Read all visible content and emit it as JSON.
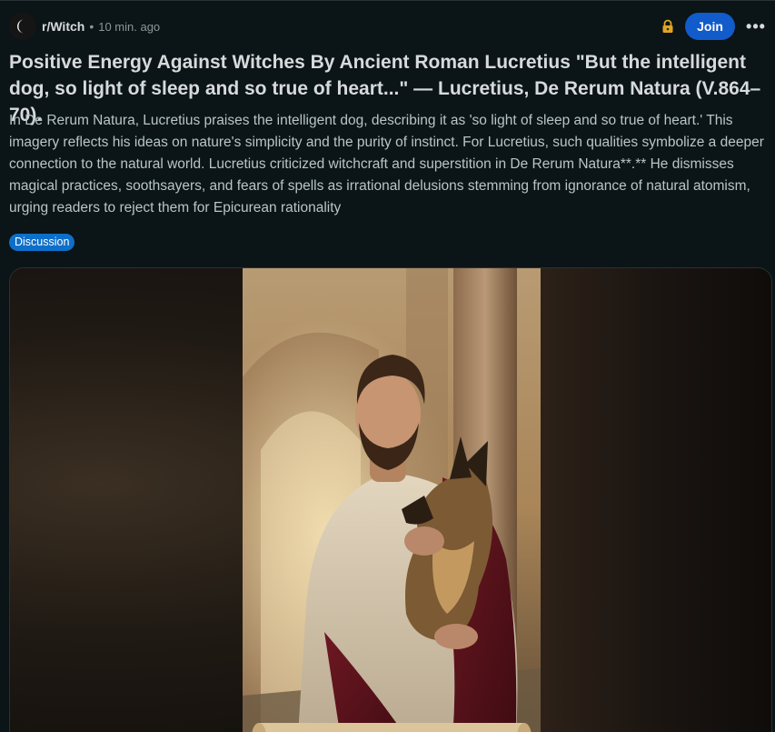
{
  "header": {
    "subreddit": "r/Witch",
    "separator": "•",
    "time": "10 min. ago",
    "join_label": "Join",
    "more_label": "•••"
  },
  "post": {
    "title": "Positive Energy Against Witches By Ancient Roman Lucretius \"But the intelligent dog, so light of sleep and so true of heart...\" — Lucretius, De Rerum Natura (V.864–70).",
    "body": "In De Rerum Natura, Lucretius praises the intelligent dog, describing it as 'so light of sleep and so true of heart.' This imagery reflects his ideas on nature's simplicity and the purity of instinct. For Lucretius, such qualities symbolize a deeper connection to the natural world. Lucretius criticized witchcraft and superstition in De Rerum Natura**.** He dismisses magical practices, soothsayers, and fears of spells as irrational delusions stemming from ignorance of natural atomism, urging readers to reject them for Epicurean rationality",
    "flair": "Discussion"
  },
  "icons": {
    "avatar": "crescent-moon-icon",
    "lock": "lock-icon",
    "more": "more-options-icon"
  },
  "colors": {
    "background": "#0b1416",
    "join_button": "#115bca",
    "flair": "#0e6fc9",
    "lock": "#e0a526"
  }
}
